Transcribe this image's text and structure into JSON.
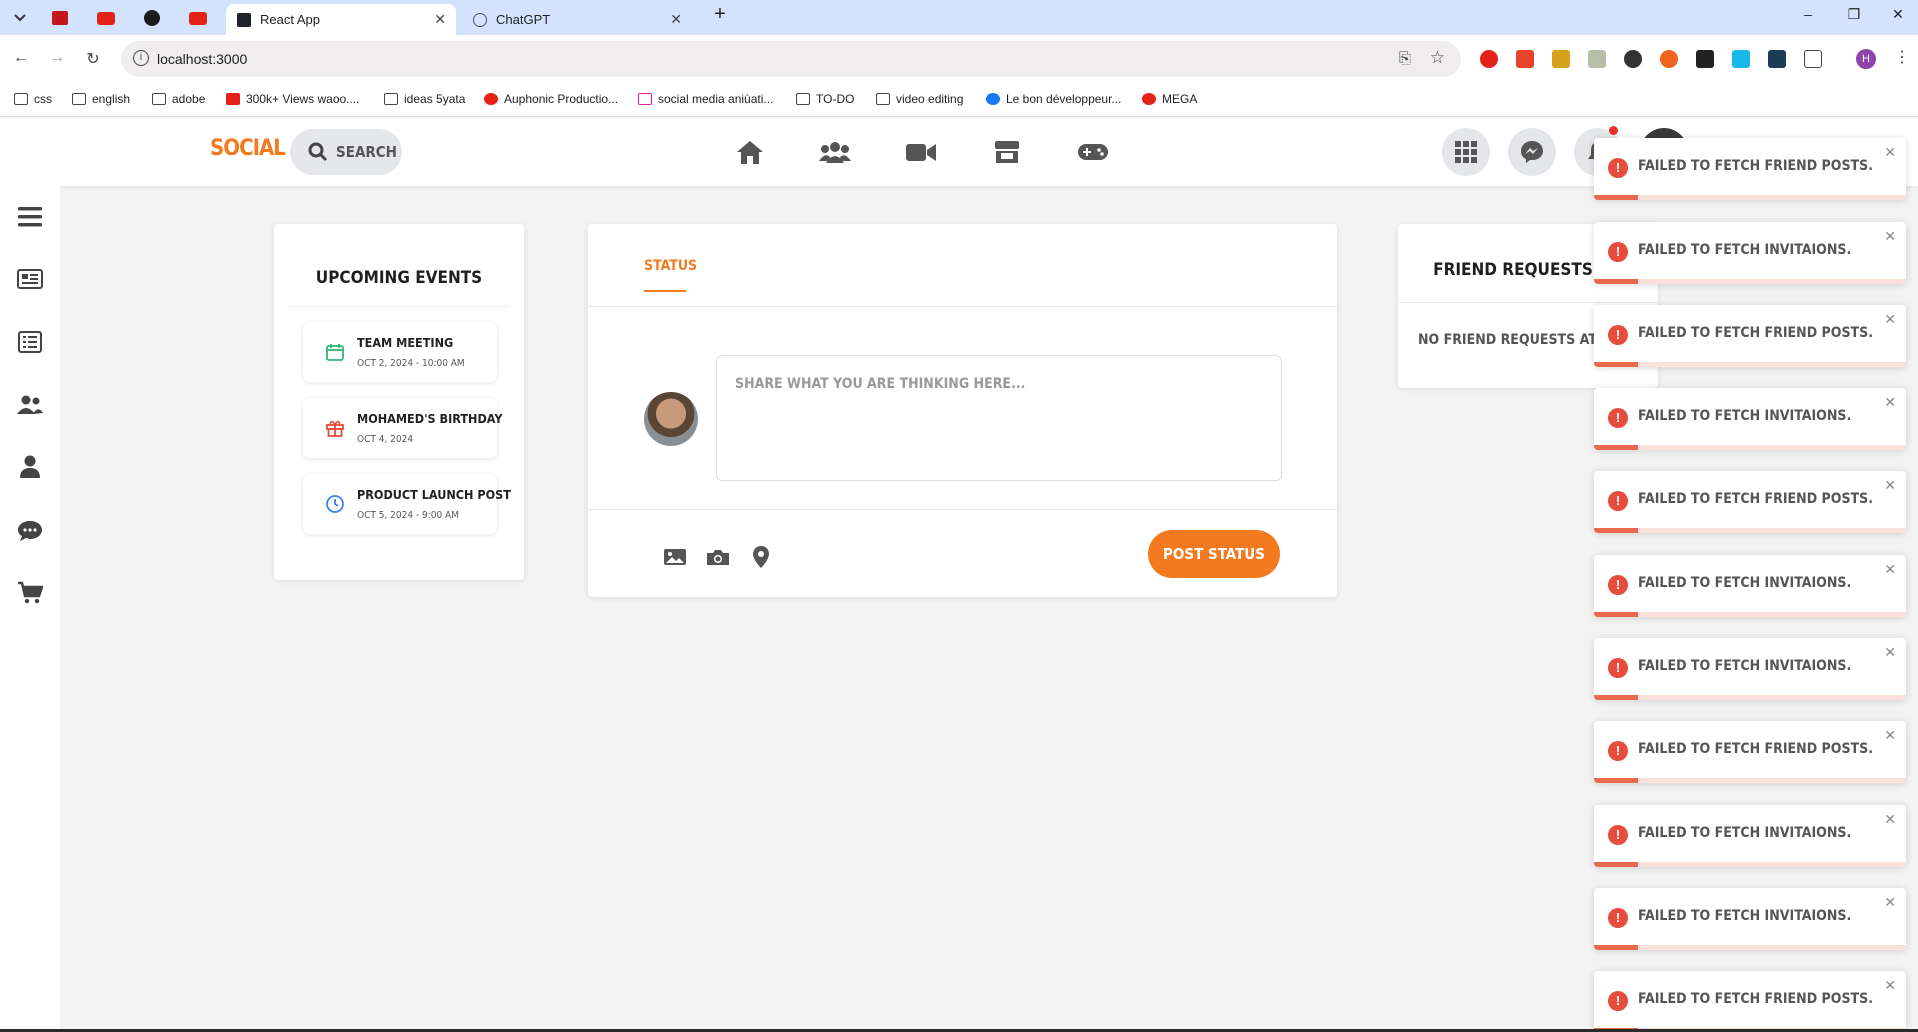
{
  "browser": {
    "tabs": [
      {
        "label": "React App",
        "active": true
      },
      {
        "label": "ChatGPT",
        "active": false
      }
    ],
    "new_tab": "+",
    "tab_close": "✕",
    "url": "localhost:3000",
    "window_controls": {
      "minimize": "–",
      "restore": "❐",
      "close": "✕"
    },
    "bookmarks": [
      "css",
      "english",
      "adobe",
      "300k+ Views waoo....",
      "ideas 5yata",
      "Auphonic Productio...",
      "social media aniùati...",
      "TO-DO",
      "video editing",
      "Le bon développeur...",
      "MEGA"
    ],
    "profile_initial": "H"
  },
  "app": {
    "logo": "SOCIAL",
    "search_label": "SEARCH",
    "nav_icons": [
      "home-icon",
      "friends-icon",
      "video-icon",
      "store-icon",
      "gaming-icon"
    ],
    "header_buttons": [
      "apps-grid-icon",
      "messenger-icon",
      "bell-icon"
    ],
    "sidebar_icons": [
      "newspaper-icon",
      "list-icon",
      "users-icon",
      "user-icon",
      "comment-icon",
      "cart-icon"
    ]
  },
  "events": {
    "title": "UPCOMING EVENTS",
    "items": [
      {
        "title": "TEAM MEETING",
        "date": "OCT 2, 2024 - 10:00 AM",
        "icon": "calendar-icon",
        "color": "#2eb872"
      },
      {
        "title": "MOHAMED'S BIRTHDAY",
        "date": "OCT 4, 2024",
        "icon": "gift-icon",
        "color": "#e74c3c"
      },
      {
        "title": "PRODUCT LAUNCH POST",
        "date": "OCT 5, 2024 - 9:00 AM",
        "icon": "clock-icon",
        "color": "#3b82f6"
      }
    ]
  },
  "status": {
    "tab_label": "STATUS",
    "placeholder": "SHARE WHAT YOU ARE THINKING HERE...",
    "post_button": "POST STATUS",
    "accent": "#f47a20"
  },
  "friend_requests": {
    "title": "FRIEND REQUESTS",
    "empty_text": "NO FRIEND REQUESTS AT THE M"
  },
  "toasts": [
    {
      "message": "FAILED TO FETCH FRIEND POSTS."
    },
    {
      "message": "FAILED TO FETCH INVITAIONS."
    },
    {
      "message": "FAILED TO FETCH FRIEND POSTS."
    },
    {
      "message": "FAILED TO FETCH INVITAIONS."
    },
    {
      "message": "FAILED TO FETCH FRIEND POSTS."
    },
    {
      "message": "FAILED TO FETCH INVITAIONS."
    },
    {
      "message": "FAILED TO FETCH INVITAIONS."
    },
    {
      "message": "FAILED TO FETCH FRIEND POSTS."
    },
    {
      "message": "FAILED TO FETCH INVITAIONS."
    },
    {
      "message": "FAILED TO FETCH INVITAIONS."
    },
    {
      "message": "FAILED TO FETCH FRIEND POSTS."
    }
  ],
  "toast_icon": "!",
  "toast_close": "✕"
}
